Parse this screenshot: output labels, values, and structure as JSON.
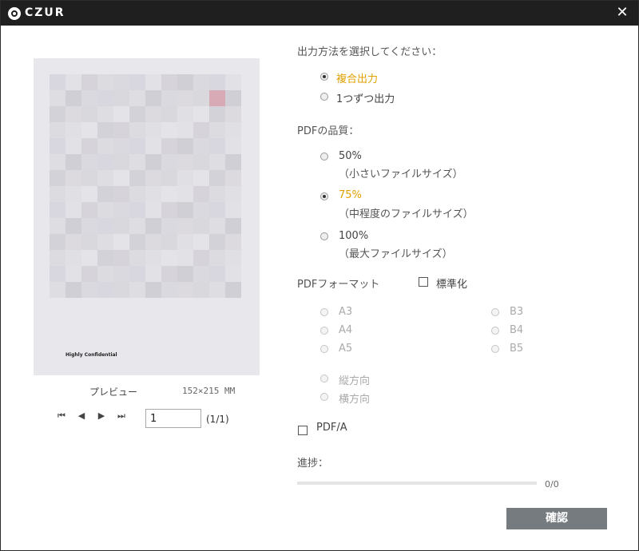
{
  "window": {
    "brand": "CZUR",
    "close_icon": "close-icon"
  },
  "preview": {
    "label": "プレビュー",
    "size": "152×215 MM",
    "watermark_text": "Highly Confidential",
    "page_value": "1",
    "page_total": "(1/1)"
  },
  "output": {
    "heading": "出力方法を選択してください：",
    "options": [
      {
        "label": "複合出力",
        "selected": true
      },
      {
        "label": "1つずつ出力",
        "selected": false
      }
    ]
  },
  "quality": {
    "heading": "PDFの品質：",
    "options": [
      {
        "label": "50%",
        "sub": "（小さいファイルサイズ）",
        "selected": false
      },
      {
        "label": "75%",
        "sub": "（中程度のファイルサイズ）",
        "selected": true
      },
      {
        "label": "100%",
        "sub": "（最大ファイルサイズ）",
        "selected": false
      }
    ]
  },
  "format": {
    "heading": "PDFフォーマット",
    "standard_label": "標準化",
    "sizes_left": [
      "A3",
      "A4",
      "A5"
    ],
    "sizes_right": [
      "B3",
      "B4",
      "B5"
    ],
    "orientation": [
      "縦方向",
      "横方向"
    ]
  },
  "pdfa": {
    "label": "PDF/A"
  },
  "progress": {
    "label": "進捗：",
    "count": "0/0",
    "fraction": 0
  },
  "confirm_label": "確認",
  "colors": {
    "accent": "#e0a100",
    "titlebar": "#1f1f1f",
    "button": "#767b80"
  }
}
